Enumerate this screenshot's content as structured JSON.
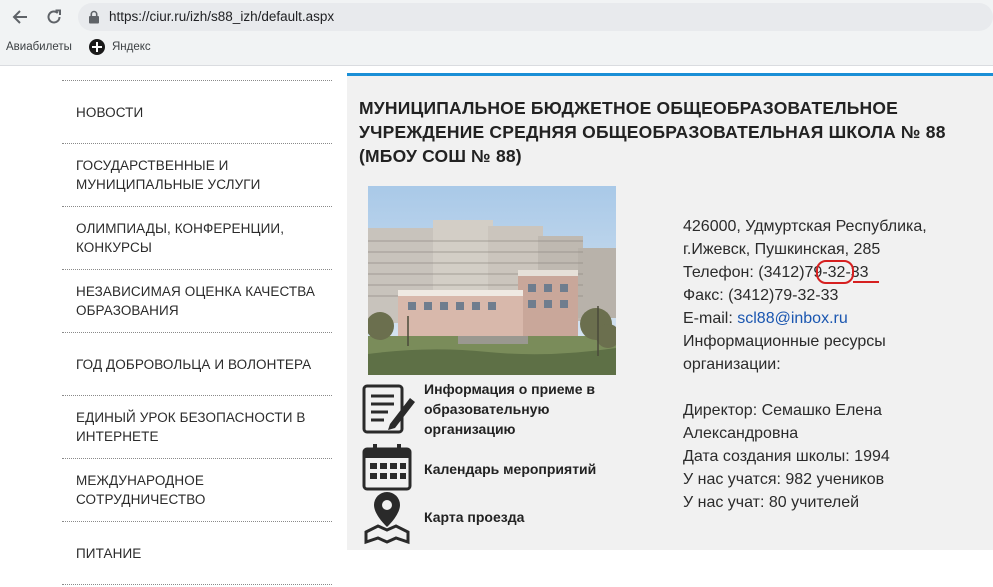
{
  "browser": {
    "url": "https://ciur.ru/izh/s88_izh/default.aspx",
    "bookmarks": [
      "Авиабилеты",
      "Яндекс"
    ],
    "icons": [
      "back-arrow-icon",
      "reload-icon",
      "lock-icon",
      "yandex-plus-icon"
    ]
  },
  "sidebar": {
    "items": [
      {
        "label": "НОВОСТИ"
      },
      {
        "label": "ГОСУДАРСТВЕННЫЕ И МУНИЦИПАЛЬНЫЕ УСЛУГИ"
      },
      {
        "label": "ОЛИМПИАДЫ, КОНФЕРЕНЦИИ, КОНКУРСЫ"
      },
      {
        "label": "НЕЗАВИСИМАЯ ОЦЕНКА КАЧЕСТВА ОБРАЗОВАНИЯ"
      },
      {
        "label": "ГОД ДОБРОВОЛЬЦА И ВОЛОНТЕРА"
      },
      {
        "label": "ЕДИНЫЙ УРОК БЕЗОПАСНОСТИ В ИНТЕРНЕТЕ"
      },
      {
        "label": "МЕЖДУНАРОДНОЕ СОТРУДНИЧЕСТВО"
      },
      {
        "label": "ПИТАНИЕ"
      }
    ]
  },
  "main": {
    "title": "МУНИЦИПАЛЬНОЕ БЮДЖЕТНОЕ ОБЩЕОБРАЗОВАТЕЛЬНОЕ УЧРЕЖДЕНИЕ СРЕДНЯЯ ОБЩЕОБРАЗОВАТЕЛЬНАЯ ШКОЛА № 88 (МБОУ СОШ № 88)",
    "links": [
      {
        "label": "Информация о приеме в образовательную организацию",
        "icon": "document-pen-icon"
      },
      {
        "label": "Календарь мероприятий",
        "icon": "calendar-icon"
      },
      {
        "label": "Карта проезда",
        "icon": "map-pin-icon"
      }
    ],
    "info": {
      "address_1": "426000, Удмуртская Республика,",
      "address_2": "г.Ижевск, Пушкинская, 285",
      "phone_label": "Телефон: (3412)",
      "phone_mid": "79-32",
      "phone_dash": "-",
      "phone_end": "33",
      "fax": "Факс: (3412)79-32-33",
      "email_label": "E-mail: ",
      "email": "scl88@inbox.ru",
      "resources_1": "Информационные ресурсы",
      "resources_2": "организации:",
      "director_1": "Директор: Семашко Елена",
      "director_2": "Александровна",
      "founded": "Дата создания школы: 1994",
      "students": "У нас учатся: 982 учеников",
      "teachers": "У нас учат: 80 учителей"
    },
    "colors": {
      "accent": "#1a8fd6",
      "link": "#1a56b0",
      "annotation": "#d62020",
      "panel_bg": "#f1f1f1"
    }
  }
}
